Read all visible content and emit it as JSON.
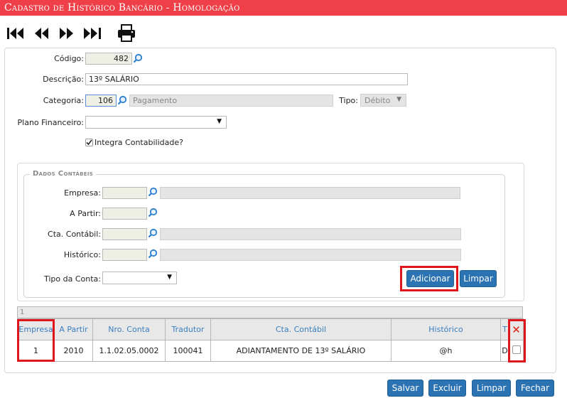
{
  "title": "Cadastro de Histórico Bancário  - Homologação",
  "toolbar": {
    "icons": [
      "first-icon",
      "previous-icon",
      "next-icon",
      "last-icon",
      "print-icon"
    ]
  },
  "form": {
    "codigo_label": "Código:",
    "codigo_value": "482",
    "descricao_label": "Descrição:",
    "descricao_value": "13º SALÁRIO",
    "categoria_label": "Categoria:",
    "categoria_code": "106",
    "categoria_name": "Pagamento",
    "tipo_label": "Tipo:",
    "tipo_value": "Débito",
    "plano_label": "Plano Financeiro:",
    "plano_value": "",
    "integra_label": "Integra Contabilidade?",
    "integra_checked": true
  },
  "dados": {
    "legend": "Dados Contábeis",
    "empresa_label": "Empresa:",
    "apartir_label": "A Partir:",
    "cta_label": "Cta. Contábil:",
    "historico_label": "Histórico:",
    "tipo_conta_label": "Tipo da Conta:",
    "tipo_conta_value": "",
    "adicionar": "Adicionar",
    "limpar": "Limpar"
  },
  "grid": {
    "pager": "1",
    "columns": [
      "Empresa",
      "A Partir",
      "Nro. Conta",
      "Tradutor",
      "Cta. Contábil",
      "Histórico",
      "T"
    ],
    "rows": [
      [
        "1",
        "2010",
        "1.1.02.05.0002",
        "100041",
        "ADIANTAMENTO DE 13º SALÁRIO",
        "@h",
        "D"
      ]
    ]
  },
  "footer": {
    "salvar": "Salvar",
    "excluir": "Excluir",
    "limpar": "Limpar",
    "fechar": "Fechar"
  },
  "colors": {
    "title_bar": "#ef3f48",
    "button": "#2b73b2",
    "highlight": "#e0151b",
    "header_text": "#3a7fc0"
  }
}
